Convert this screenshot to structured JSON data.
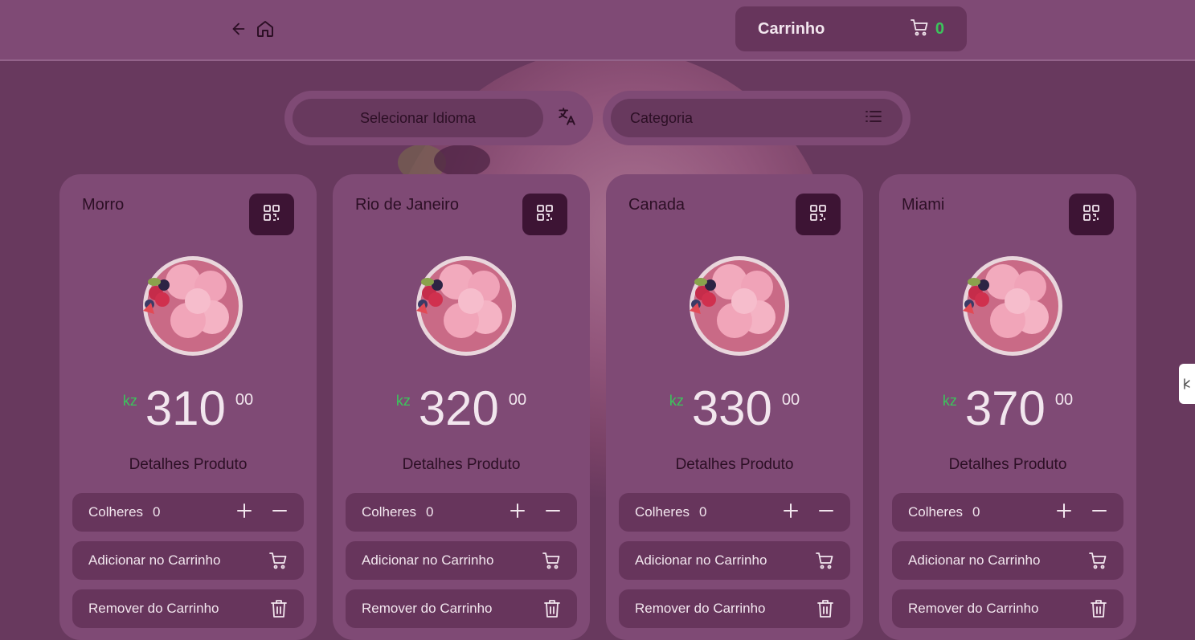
{
  "header": {
    "back_icon": "arrow-left-icon",
    "home_icon": "home-icon",
    "cart_title": "Carrinho",
    "cart_icon": "shopping-cart-icon",
    "cart_count": "0"
  },
  "filters": {
    "language_label": "Selecionar Idioma",
    "language_icon": "translate-icon",
    "category_label": "Categoria",
    "category_icon": "list-icon"
  },
  "colors": {
    "page_bg": "#68395e",
    "panel_bg": "#7f4a75",
    "button_bg": "#67355c",
    "dark_button": "#3d1434",
    "accent_green": "#3cc45c",
    "light_text": "#f2e6ee",
    "dark_text": "#2c0f25"
  },
  "products": [
    {
      "name": "Morro",
      "currency": "kz",
      "price_int": "310",
      "price_dec": "00",
      "details": "Detalhes Produto",
      "spoons_label": "Colheres",
      "spoons_count": "0",
      "add_label": "Adicionar no Carrinho",
      "remove_label": "Remover do Carrinho"
    },
    {
      "name": "Rio de Janeiro",
      "currency": "kz",
      "price_int": "320",
      "price_dec": "00",
      "details": "Detalhes Produto",
      "spoons_label": "Colheres",
      "spoons_count": "0",
      "add_label": "Adicionar no Carrinho",
      "remove_label": "Remover do Carrinho"
    },
    {
      "name": "Canada",
      "currency": "kz",
      "price_int": "330",
      "price_dec": "00",
      "details": "Detalhes Produto",
      "spoons_label": "Colheres",
      "spoons_count": "0",
      "add_label": "Adicionar no Carrinho",
      "remove_label": "Remover do Carrinho"
    },
    {
      "name": "Miami",
      "currency": "kz",
      "price_int": "370",
      "price_dec": "00",
      "details": "Detalhes Produto",
      "spoons_label": "Colheres",
      "spoons_count": "0",
      "add_label": "Adicionar no Carrinho",
      "remove_label": "Remover do Carrinho"
    }
  ],
  "card_icons": {
    "qr": "qr-code-icon",
    "plus": "plus-icon",
    "minus": "minus-icon",
    "cart": "shopping-cart-icon",
    "trash": "trash-icon"
  },
  "side_handle_icon": "drag-handle-icon"
}
